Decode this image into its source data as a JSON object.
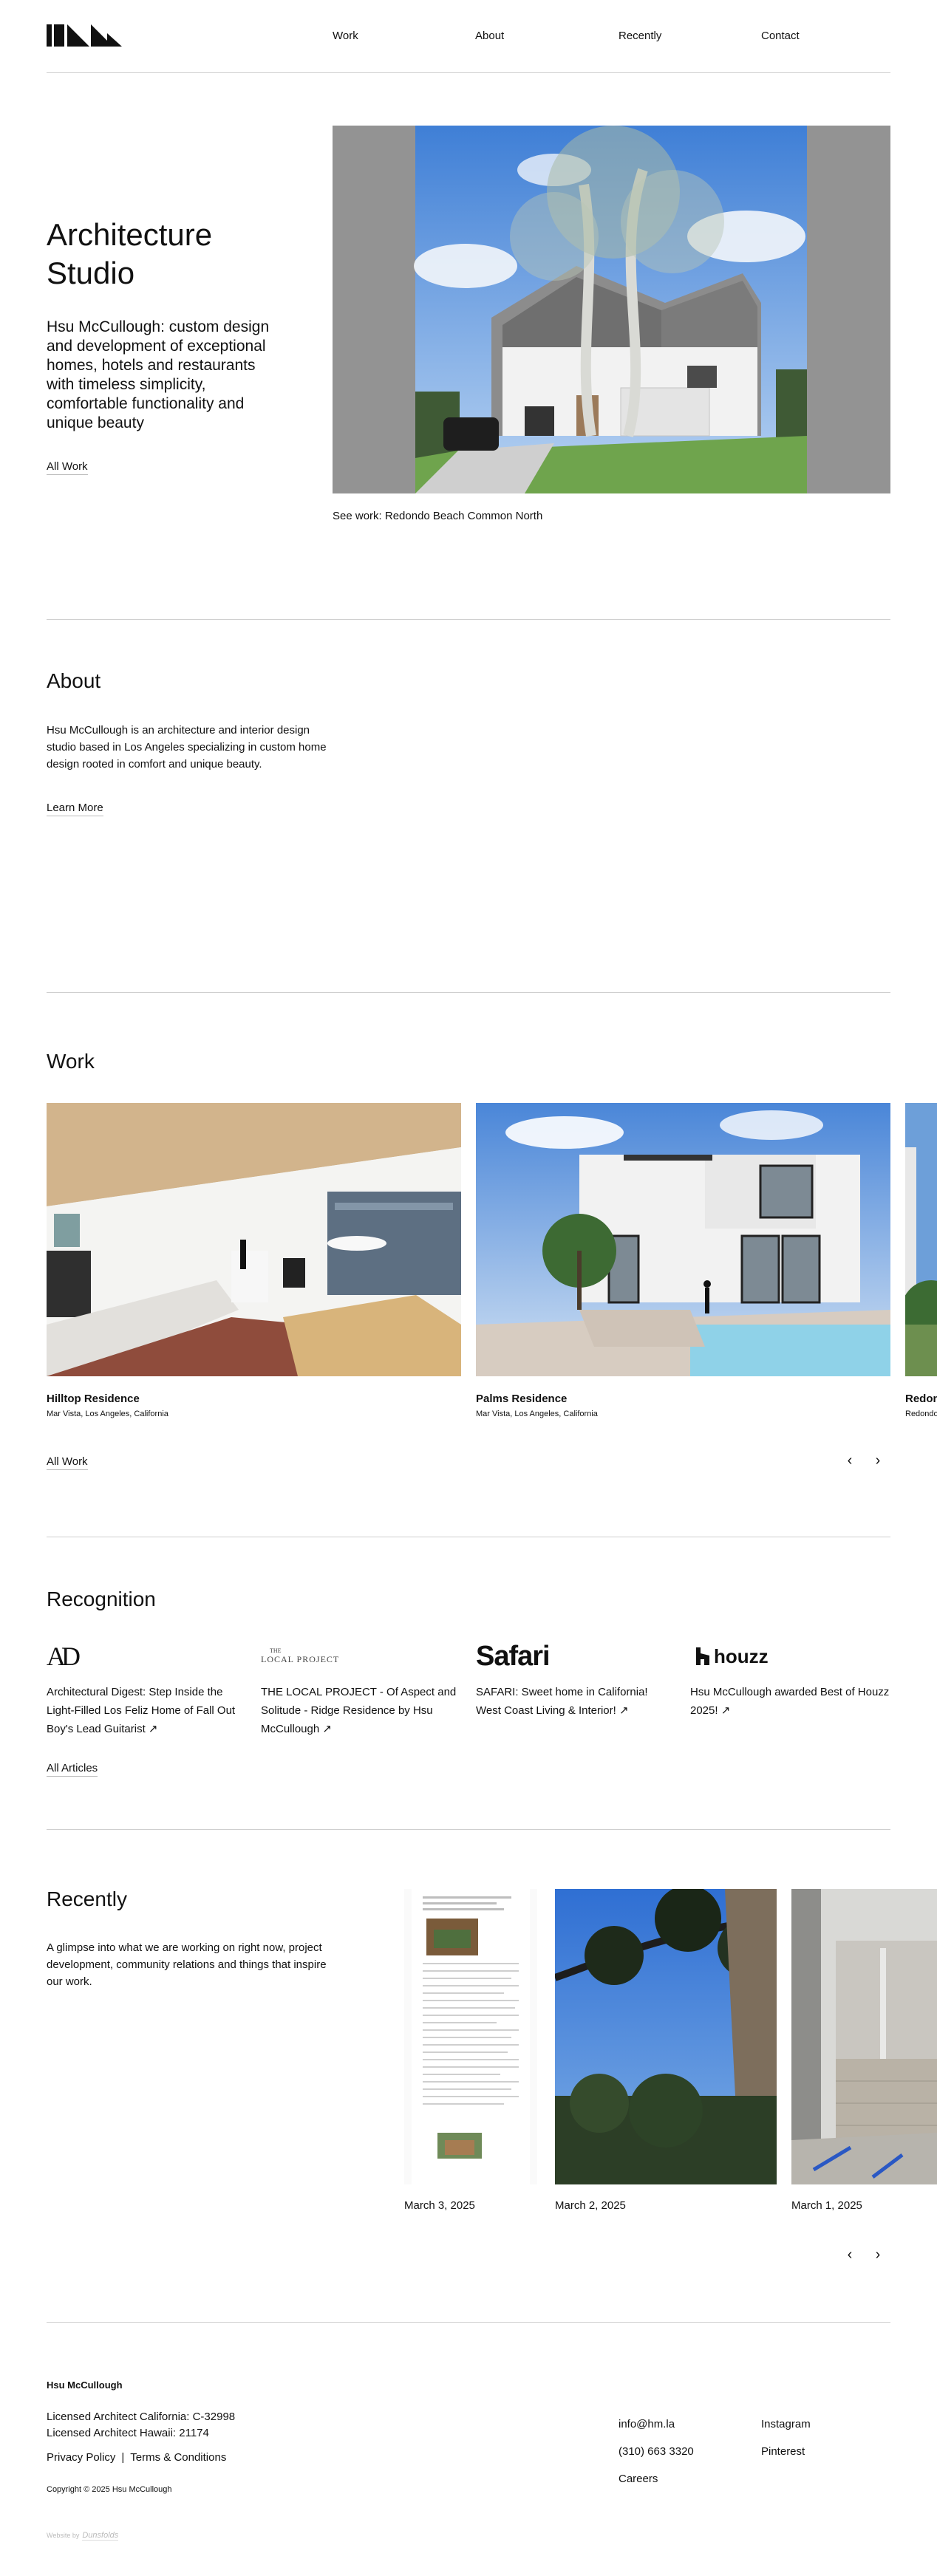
{
  "header": {
    "logo_alt": "HM",
    "nav": [
      "Work",
      "About",
      "Recently",
      "Contact"
    ]
  },
  "hero": {
    "title": "Architecture Studio",
    "description": "Hsu McCullough: custom design and development of exceptional homes, hotels and restaurants with timeless simplicity, comfortable functionality and unique beauty",
    "link": "All Work",
    "caption": "See work: Redondo Beach Common North"
  },
  "about": {
    "title": "About",
    "text": "Hsu McCullough is an architecture and interior design studio based in Los Angeles specializing in custom home design rooted in comfort and unique beauty.",
    "link": "Learn More"
  },
  "work": {
    "title": "Work",
    "items": [
      {
        "name": "Hilltop Residence",
        "location": "Mar Vista, Los Angeles, California"
      },
      {
        "name": "Palms Residence",
        "location": "Mar Vista, Los Angeles, California"
      },
      {
        "name": "Redondo",
        "location": "Redondo"
      }
    ],
    "link": "All Work",
    "prev": "‹",
    "next": "›"
  },
  "recognition": {
    "title": "Recognition",
    "items": [
      {
        "logo": "AD",
        "text": "Architectural Digest: Step Inside the Light-Filled Los Feliz Home of Fall Out Boy's Lead Guitarist ↗"
      },
      {
        "logo_top": "THE",
        "logo": "LOCAL PROJECT",
        "text": "THE LOCAL PROJECT - Of Aspect and Solitude - Ridge Residence by Hsu McCullough ↗"
      },
      {
        "logo": "Safari",
        "text": "SAFARI: Sweet home in California! West Coast Living & Interior! ↗"
      },
      {
        "logo": "houzz",
        "text": "Hsu McCullough awarded Best of Houzz 2025! ↗"
      }
    ],
    "link": "All Articles"
  },
  "recently": {
    "title": "Recently",
    "text": "A glimpse into what we are working on right now, project development, community relations and things that inspire our work.",
    "items": [
      {
        "date": "March 3, 2025"
      },
      {
        "date": "March 2, 2025"
      },
      {
        "date": "March 1, 2025"
      }
    ],
    "prev": "‹",
    "next": "›"
  },
  "footer": {
    "company": "Hsu McCullough",
    "license_ca": "Licensed Architect California:  C-32998",
    "license_hi": "Licensed Architect Hawaii:  21174",
    "privacy": "Privacy Policy",
    "separator": "|",
    "terms": "Terms & Conditions",
    "copyright": "Copyright © 2025 Hsu McCullough",
    "website_by": "Website by",
    "website_by_brand": "Dunsfolds",
    "email": "info@hm.la",
    "phone": "(310) 663 3320",
    "careers": "Careers",
    "instagram": "Instagram",
    "pinterest": "Pinterest"
  }
}
